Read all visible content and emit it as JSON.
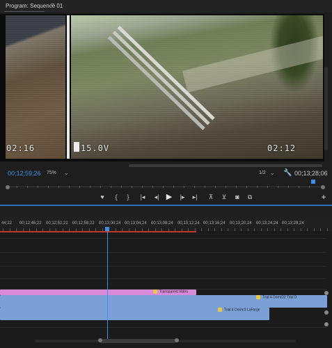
{
  "program_monitor": {
    "title": "Program: Sequence 01",
    "menu_icon": "hamburger-icon",
    "osd": {
      "left_timer": "02:16",
      "voltage": "15.0V",
      "right_timer": "02:12"
    },
    "timecode_current": "00;12;59;26",
    "zoom": "75%",
    "resolution": "1/2",
    "timecode_duration": "00;13;28;06",
    "wrench_icon": "wrench-icon"
  },
  "transport": [
    {
      "name": "add-marker-button",
      "icon": "marker-icon",
      "glyph": "♥"
    },
    {
      "name": "mark-in-button",
      "icon": "mark-in-icon",
      "glyph": "{"
    },
    {
      "name": "mark-out-button",
      "icon": "mark-out-icon",
      "glyph": "}"
    },
    {
      "name": "go-to-in-button",
      "icon": "go-to-in-icon",
      "glyph": "|◂"
    },
    {
      "name": "step-back-button",
      "icon": "step-back-icon",
      "glyph": "◂|"
    },
    {
      "name": "play-button",
      "icon": "play-icon",
      "glyph": "▶"
    },
    {
      "name": "step-forward-button",
      "icon": "step-forward-icon",
      "glyph": "|▸"
    },
    {
      "name": "go-to-out-button",
      "icon": "go-to-out-icon",
      "glyph": "▸|"
    },
    {
      "name": "lift-button",
      "icon": "lift-icon",
      "glyph": "⊼"
    },
    {
      "name": "extract-button",
      "icon": "extract-icon",
      "glyph": "⊻"
    },
    {
      "name": "export-frame-button",
      "icon": "camera-icon",
      "glyph": "◙"
    },
    {
      "name": "comparison-view-button",
      "icon": "comparison-icon",
      "glyph": "⧉"
    },
    {
      "name": "add-button",
      "icon": "plus-icon",
      "glyph": "+"
    }
  ],
  "timeline": {
    "ruler_labels": [
      "44;22",
      "00;12;46;22",
      "00;12;52;22",
      "00;12;58;22",
      "00;13;00;24",
      "00;13;04;24",
      "00;13;08;24",
      "00;13;12;24",
      "00;13;16;24",
      "00;13;20;24",
      "00;13;24;24",
      "00;13;28;24"
    ],
    "clips": [
      {
        "name": "Transparent Video",
        "color": "#d98ad9",
        "fx": "fx-icon"
      },
      {
        "name": "Trial 4 DormD2 Trial D",
        "color": "#7aa0d6",
        "fx": "fx-icon"
      },
      {
        "name": "Trial 4 Dorm/3 LaForge",
        "color": "#7aa0d6",
        "fx": "fx-icon"
      }
    ],
    "accent": "#3b8fe6",
    "render_bar_color": "#c0392b"
  }
}
